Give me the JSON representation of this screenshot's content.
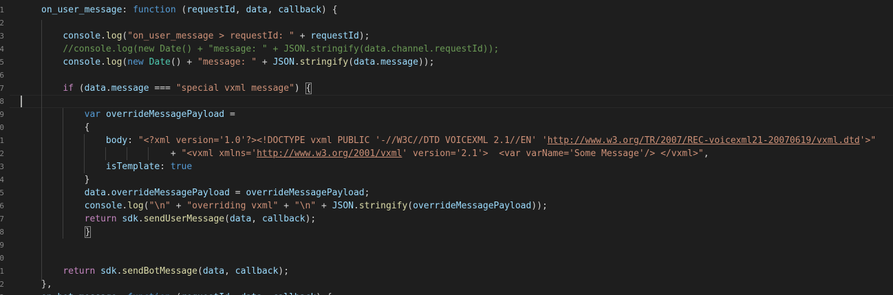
{
  "colors": {
    "background": "#1e1e1e",
    "text": "#d4d4d4",
    "keyword": "#569cd6",
    "control": "#c586c0",
    "string": "#ce9178",
    "variable": "#9cdcfe",
    "function": "#dcdcaa",
    "type": "#4ec9b0",
    "comment": "#6a9955",
    "line_number": "#858585"
  },
  "editor": {
    "line_numbers": [
      "1",
      "2",
      "3",
      "4",
      "5",
      "6",
      "7",
      "8",
      "9",
      "0",
      "1",
      "2",
      "3",
      "4",
      "5",
      "6",
      "7",
      "8",
      "9",
      "0",
      "1",
      "2",
      "3"
    ],
    "lines": [
      [
        {
          "t": "on_user_message",
          "c": "variable"
        },
        {
          "t": ": ",
          "c": "text"
        },
        {
          "t": "function",
          "c": "keyword"
        },
        {
          "t": " (",
          "c": "text"
        },
        {
          "t": "requestId",
          "c": "variable"
        },
        {
          "t": ", ",
          "c": "text"
        },
        {
          "t": "data",
          "c": "variable"
        },
        {
          "t": ", ",
          "c": "text"
        },
        {
          "t": "callback",
          "c": "variable"
        },
        {
          "t": ") {",
          "c": "text"
        }
      ],
      [],
      [
        {
          "t": "    ",
          "c": "text"
        },
        {
          "t": "console",
          "c": "variable"
        },
        {
          "t": ".",
          "c": "text"
        },
        {
          "t": "log",
          "c": "function"
        },
        {
          "t": "(",
          "c": "text"
        },
        {
          "t": "\"on_user_message > requestId: \"",
          "c": "string"
        },
        {
          "t": " + ",
          "c": "text"
        },
        {
          "t": "requestId",
          "c": "variable"
        },
        {
          "t": ");",
          "c": "text"
        }
      ],
      [
        {
          "t": "    ",
          "c": "text"
        },
        {
          "t": "//console.log(new Date() + \"message: \" + JSON.stringify(data.channel.requestId));",
          "c": "comment"
        }
      ],
      [
        {
          "t": "    ",
          "c": "text"
        },
        {
          "t": "console",
          "c": "variable"
        },
        {
          "t": ".",
          "c": "text"
        },
        {
          "t": "log",
          "c": "function"
        },
        {
          "t": "(",
          "c": "text"
        },
        {
          "t": "new",
          "c": "keyword"
        },
        {
          "t": " ",
          "c": "text"
        },
        {
          "t": "Date",
          "c": "type"
        },
        {
          "t": "() + ",
          "c": "text"
        },
        {
          "t": "\"message: \"",
          "c": "string"
        },
        {
          "t": " + ",
          "c": "text"
        },
        {
          "t": "JSON",
          "c": "variable"
        },
        {
          "t": ".",
          "c": "text"
        },
        {
          "t": "stringify",
          "c": "function"
        },
        {
          "t": "(",
          "c": "text"
        },
        {
          "t": "data",
          "c": "variable"
        },
        {
          "t": ".",
          "c": "text"
        },
        {
          "t": "message",
          "c": "variable"
        },
        {
          "t": "));",
          "c": "text"
        }
      ],
      [],
      [
        {
          "t": "    ",
          "c": "text"
        },
        {
          "t": "if",
          "c": "control"
        },
        {
          "t": " (",
          "c": "text"
        },
        {
          "t": "data",
          "c": "variable"
        },
        {
          "t": ".",
          "c": "text"
        },
        {
          "t": "message",
          "c": "variable"
        },
        {
          "t": " === ",
          "c": "text"
        },
        {
          "t": "\"special vxml message\"",
          "c": "string"
        },
        {
          "t": ") ",
          "c": "text"
        },
        {
          "t": "{",
          "c": "text",
          "box": true
        }
      ],
      [],
      [
        {
          "t": "        ",
          "c": "text"
        },
        {
          "t": "var",
          "c": "keyword"
        },
        {
          "t": " ",
          "c": "text"
        },
        {
          "t": "overrideMessagePayload",
          "c": "variable"
        },
        {
          "t": " =",
          "c": "text"
        }
      ],
      [
        {
          "t": "        {",
          "c": "text"
        }
      ],
      [
        {
          "t": "            ",
          "c": "text"
        },
        {
          "t": "body",
          "c": "variable"
        },
        {
          "t": ": ",
          "c": "text"
        },
        {
          "t": "\"<?xml version='1.0'?><!DOCTYPE vxml PUBLIC '-//W3C//DTD VOICEXML 2.1//EN' '",
          "c": "string"
        },
        {
          "t": "http://www.w3.org/TR/2007/REC-voicexml21-20070619/vxml.dtd",
          "c": "string",
          "u": true
        },
        {
          "t": "'>\"",
          "c": "string"
        }
      ],
      [
        {
          "t": "                        + ",
          "c": "text"
        },
        {
          "t": "\"<vxml xmlns='",
          "c": "string"
        },
        {
          "t": "http://www.w3.org/2001/vxml",
          "c": "string",
          "u": true
        },
        {
          "t": "' version='2.1'>  <var varName='Some Message'/> </vxml>\"",
          "c": "string"
        },
        {
          "t": ",",
          "c": "text"
        }
      ],
      [
        {
          "t": "            ",
          "c": "text"
        },
        {
          "t": "isTemplate",
          "c": "variable"
        },
        {
          "t": ": ",
          "c": "text"
        },
        {
          "t": "true",
          "c": "keyword"
        }
      ],
      [
        {
          "t": "        }",
          "c": "text"
        }
      ],
      [
        {
          "t": "        ",
          "c": "text"
        },
        {
          "t": "data",
          "c": "variable"
        },
        {
          "t": ".",
          "c": "text"
        },
        {
          "t": "overrideMessagePayload",
          "c": "variable"
        },
        {
          "t": " = ",
          "c": "text"
        },
        {
          "t": "overrideMessagePayload",
          "c": "variable"
        },
        {
          "t": ";",
          "c": "text"
        }
      ],
      [
        {
          "t": "        ",
          "c": "text"
        },
        {
          "t": "console",
          "c": "variable"
        },
        {
          "t": ".",
          "c": "text"
        },
        {
          "t": "log",
          "c": "function"
        },
        {
          "t": "(",
          "c": "text"
        },
        {
          "t": "\"\\n\"",
          "c": "string"
        },
        {
          "t": " + ",
          "c": "text"
        },
        {
          "t": "\"overriding vxml\"",
          "c": "string"
        },
        {
          "t": " + ",
          "c": "text"
        },
        {
          "t": "\"\\n\"",
          "c": "string"
        },
        {
          "t": " + ",
          "c": "text"
        },
        {
          "t": "JSON",
          "c": "variable"
        },
        {
          "t": ".",
          "c": "text"
        },
        {
          "t": "stringify",
          "c": "function"
        },
        {
          "t": "(",
          "c": "text"
        },
        {
          "t": "overrideMessagePayload",
          "c": "variable"
        },
        {
          "t": "));",
          "c": "text"
        }
      ],
      [
        {
          "t": "        ",
          "c": "text"
        },
        {
          "t": "return",
          "c": "control"
        },
        {
          "t": " ",
          "c": "text"
        },
        {
          "t": "sdk",
          "c": "variable"
        },
        {
          "t": ".",
          "c": "text"
        },
        {
          "t": "sendUserMessage",
          "c": "function"
        },
        {
          "t": "(",
          "c": "text"
        },
        {
          "t": "data",
          "c": "variable"
        },
        {
          "t": ", ",
          "c": "text"
        },
        {
          "t": "callback",
          "c": "variable"
        },
        {
          "t": ");",
          "c": "text"
        }
      ],
      [
        {
          "t": "        ",
          "c": "text"
        },
        {
          "t": "}",
          "c": "text",
          "box": true
        }
      ],
      [],
      [],
      [
        {
          "t": "    ",
          "c": "text"
        },
        {
          "t": "return",
          "c": "control"
        },
        {
          "t": " ",
          "c": "text"
        },
        {
          "t": "sdk",
          "c": "variable"
        },
        {
          "t": ".",
          "c": "text"
        },
        {
          "t": "sendBotMessage",
          "c": "function"
        },
        {
          "t": "(",
          "c": "text"
        },
        {
          "t": "data",
          "c": "variable"
        },
        {
          "t": ", ",
          "c": "text"
        },
        {
          "t": "callback",
          "c": "variable"
        },
        {
          "t": ");",
          "c": "text"
        }
      ],
      [
        {
          "t": "},",
          "c": "text"
        }
      ],
      [
        {
          "t": "on_bot_message",
          "c": "variable"
        },
        {
          "t": ": ",
          "c": "text"
        },
        {
          "t": "function",
          "c": "keyword"
        },
        {
          "t": " (",
          "c": "text"
        },
        {
          "t": "requestId",
          "c": "variable"
        },
        {
          "t": ", ",
          "c": "text"
        },
        {
          "t": "data",
          "c": "variable"
        },
        {
          "t": ", ",
          "c": "text"
        },
        {
          "t": "callback",
          "c": "variable"
        },
        {
          "t": ") {",
          "c": "text"
        }
      ]
    ]
  }
}
